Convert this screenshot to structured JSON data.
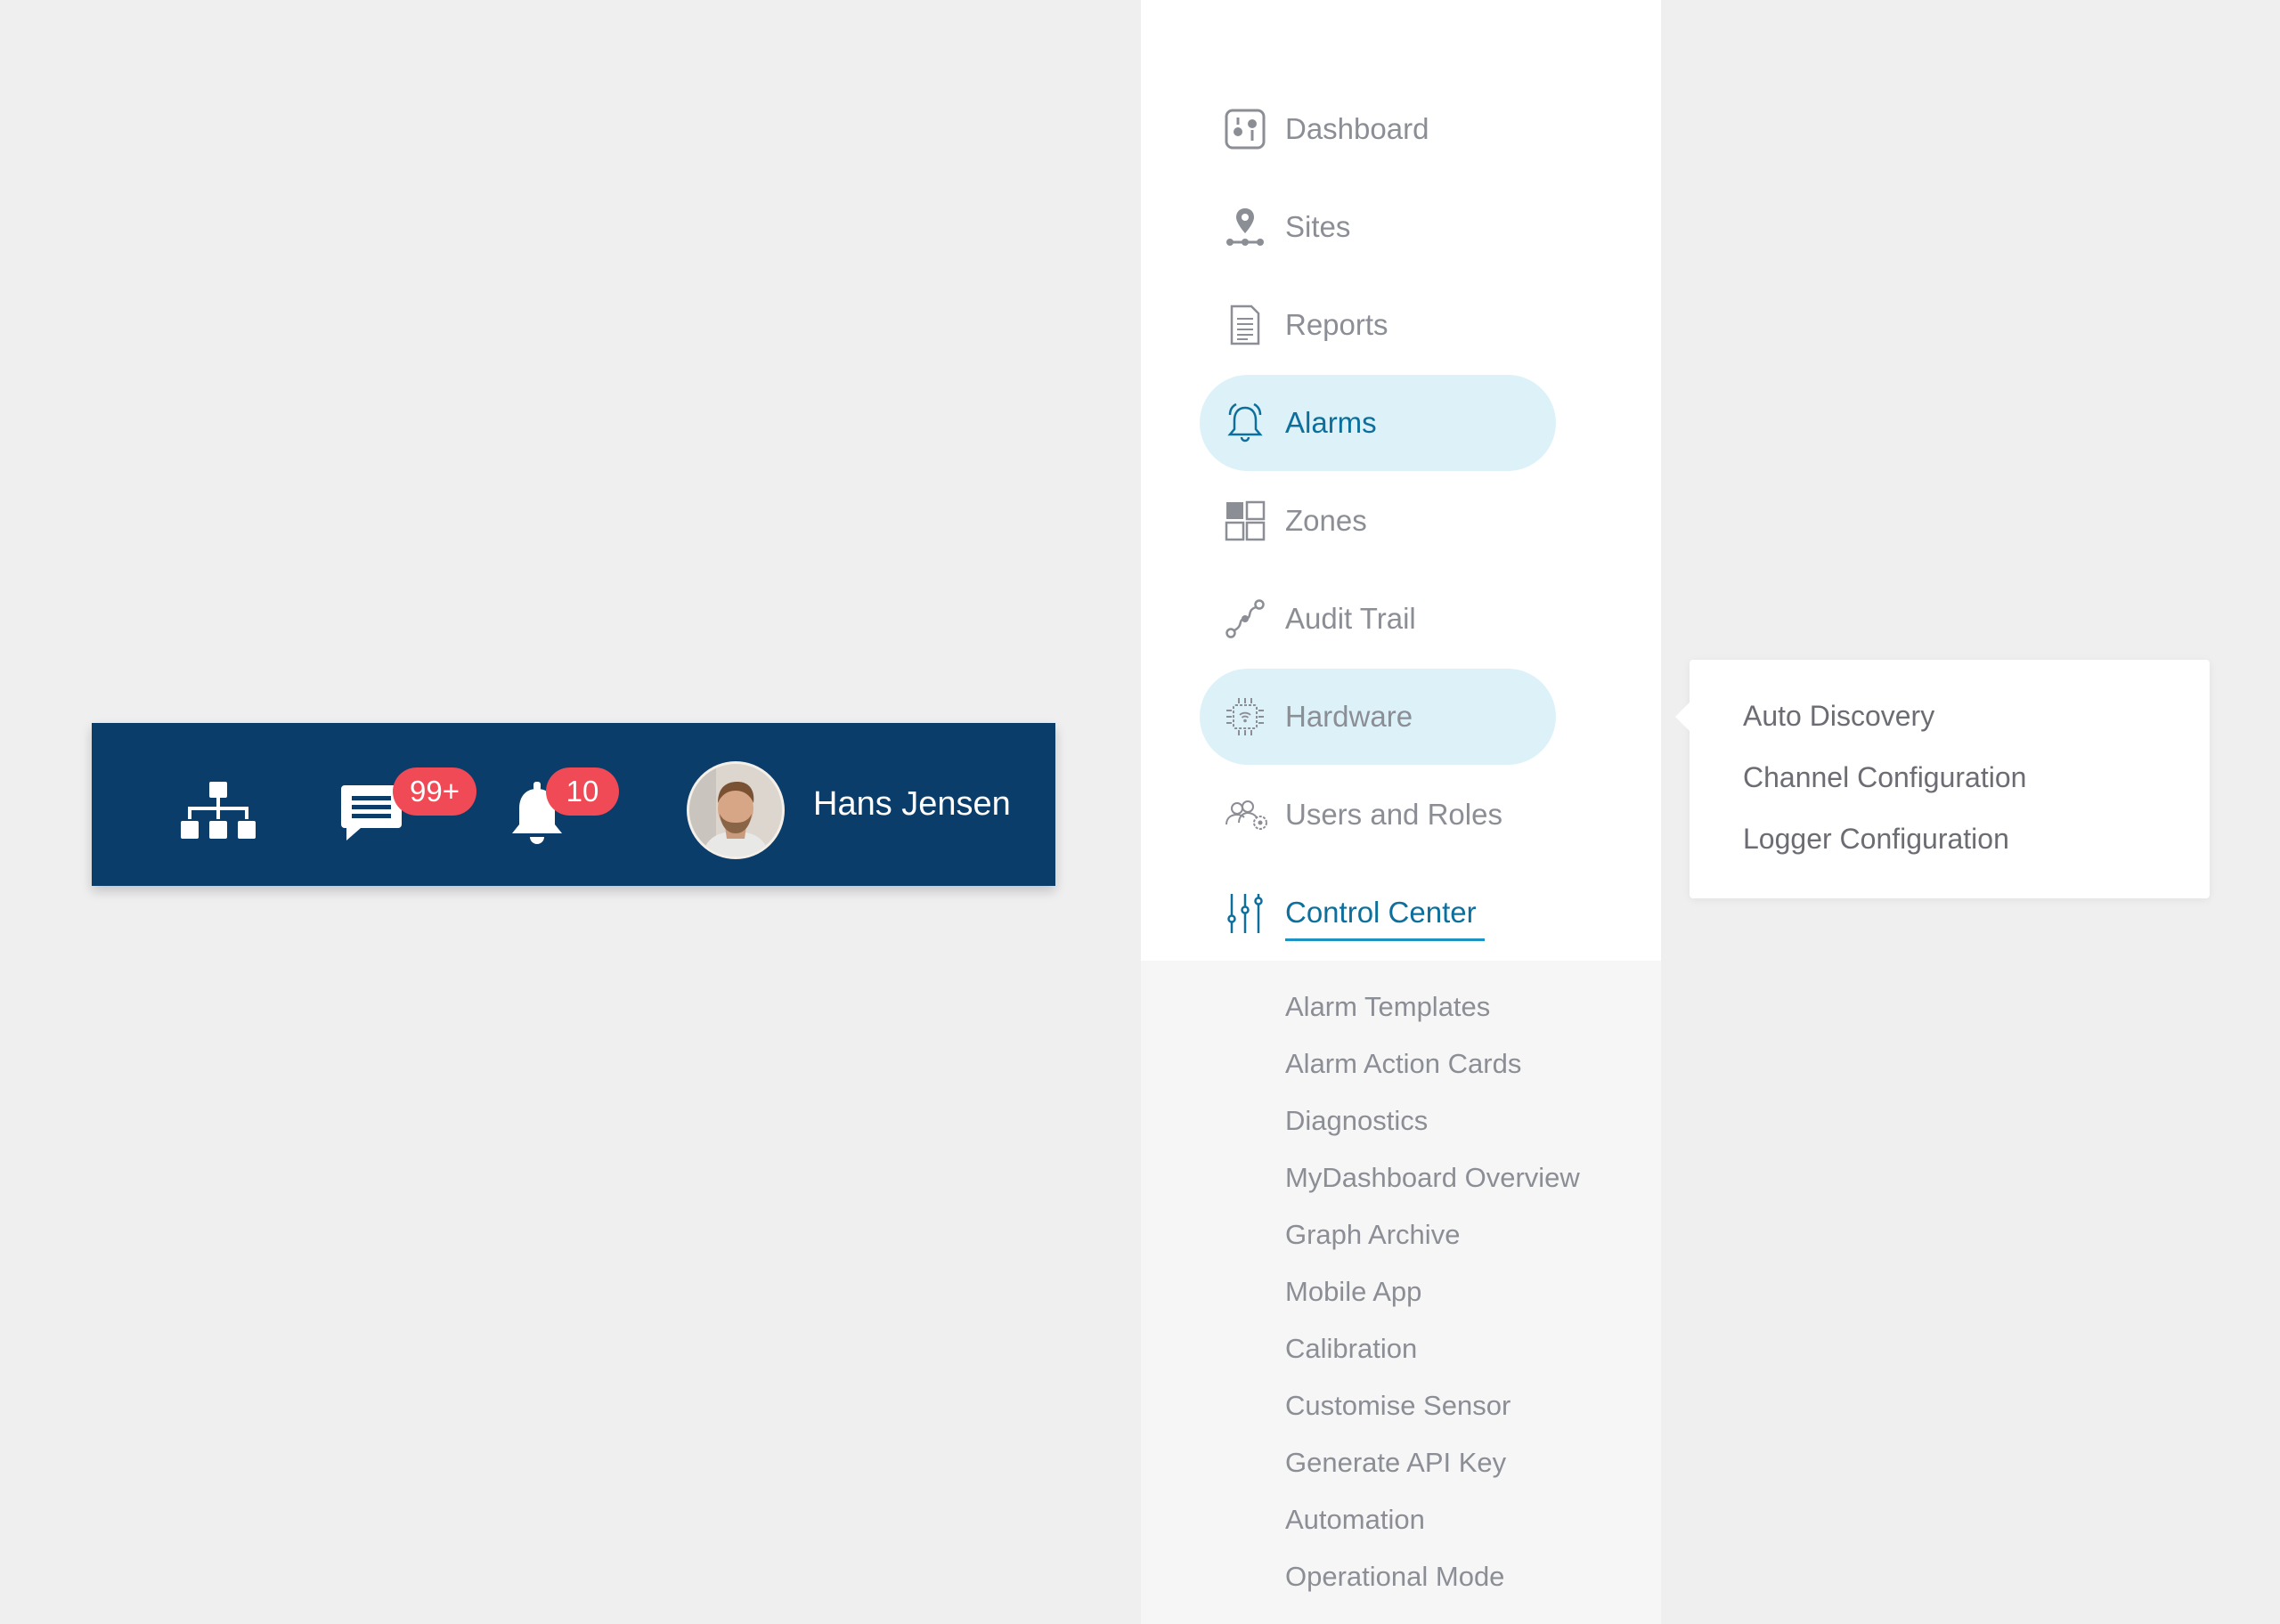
{
  "topbar": {
    "messages_badge": "99+",
    "notifications_badge": "10",
    "user_name": "Hans Jensen",
    "background": "#0b3d6a",
    "badge_color": "#ef4a55"
  },
  "sidenav": {
    "items": [
      {
        "label": "Dashboard",
        "icon": "dashboard-icon"
      },
      {
        "label": "Sites",
        "icon": "location-pin-icon"
      },
      {
        "label": "Reports",
        "icon": "document-icon"
      },
      {
        "label": "Alarms",
        "icon": "alarm-bell-icon",
        "active": true
      },
      {
        "label": "Zones",
        "icon": "grid-icon"
      },
      {
        "label": "Audit Trail",
        "icon": "trail-icon"
      },
      {
        "label": "Hardware",
        "icon": "chip-icon",
        "active": true
      },
      {
        "label": "Users and Roles",
        "icon": "users-icon"
      },
      {
        "label": "Control Center",
        "icon": "sliders-icon",
        "expanded": true
      }
    ],
    "active_background": "#dcf2f8",
    "accent": "#0d6f9c",
    "control_center_sub": [
      "Alarm Templates",
      "Alarm Action Cards",
      "Diagnostics",
      "MyDashboard Overview",
      "Graph Archive",
      "Mobile App",
      "Calibration",
      "Customise Sensor",
      "Generate API Key",
      "Automation",
      "Operational Mode"
    ]
  },
  "hardware_flyout": {
    "items": [
      "Auto Discovery",
      "Channel Configuration",
      "Logger Configuration"
    ]
  }
}
